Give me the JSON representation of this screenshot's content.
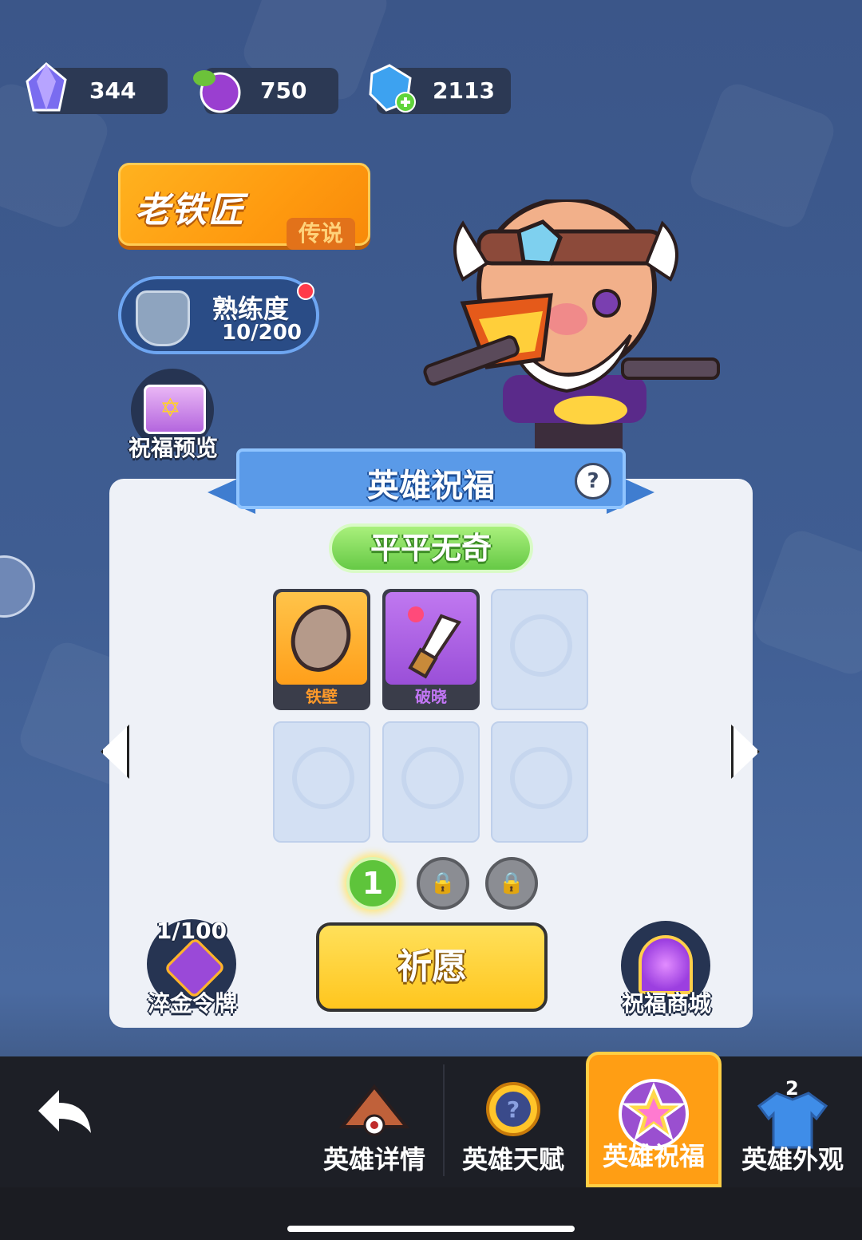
{
  "currencies": [
    {
      "icon": "crystal-icon",
      "value": "344"
    },
    {
      "icon": "grape-fruit-icon",
      "value": "750"
    },
    {
      "icon": "blue-gem-plus-icon",
      "value": "2113"
    }
  ],
  "hero": {
    "name": "老铁匠",
    "rarity": "传说",
    "proficiency_label": "熟练度",
    "proficiency_value": "10/200"
  },
  "blessing_preview_label": "祝福预览",
  "panel": {
    "title": "英雄祝福",
    "help": "?",
    "quality": "平平无奇",
    "slots": [
      {
        "label": "铁壁",
        "icon": "shield-disc-icon",
        "color": "#ffb21f",
        "label_color": "#ff9a2a"
      },
      {
        "label": "破晓",
        "icon": "spear-icon",
        "color": "#a55ce0",
        "label_color": "#c276f5"
      }
    ],
    "pages": [
      "1",
      "lock",
      "lock"
    ],
    "pray_label": "祈愿",
    "token_count": "1/100",
    "token_label": "淬金令牌",
    "shop_label": "祝福商城"
  },
  "tabs": [
    {
      "label": "英雄详情",
      "icon": "hero-detail-icon",
      "active": false
    },
    {
      "label": "英雄天赋",
      "icon": "talent-icon",
      "active": false
    },
    {
      "label": "英雄祝福",
      "icon": "blessing-star-icon",
      "active": true
    },
    {
      "label": "英雄外观",
      "icon": "shirt-icon",
      "active": false
    }
  ],
  "tab_badge": "2",
  "colors": {
    "accent": "#ff9e14",
    "panel": "#eef1f7",
    "ribbon": "#5a9ae8",
    "quality_green": "#66c946"
  }
}
